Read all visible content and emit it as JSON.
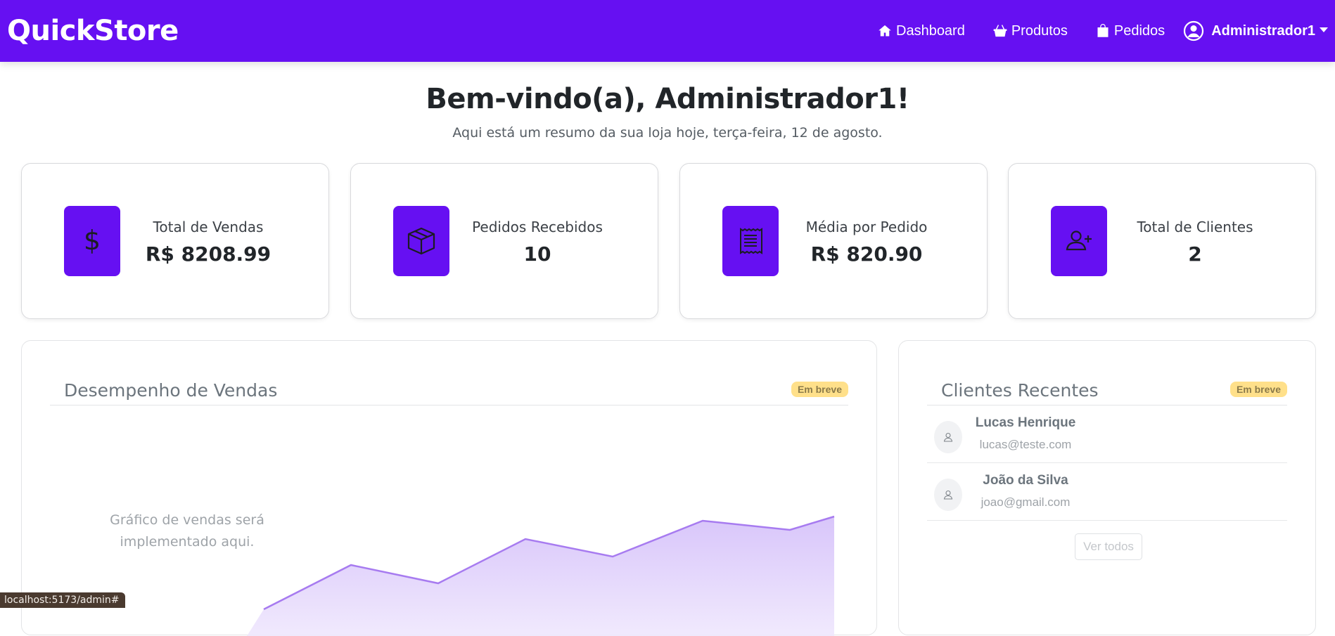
{
  "brand": "QuickStore",
  "nav": {
    "dashboard": "Dashboard",
    "produtos": "Produtos",
    "pedidos": "Pedidos",
    "user": "Administrador1"
  },
  "welcome": {
    "title": "Bem-vindo(a), Administrador1!",
    "subtitle": "Aqui está um resumo da sua loja hoje, terça-feira, 12 de agosto."
  },
  "stats": [
    {
      "label": "Total de Vendas",
      "value": "R$ 8208.99",
      "icon": "dollar-icon"
    },
    {
      "label": "Pedidos Recebidos",
      "value": "10",
      "icon": "box-icon"
    },
    {
      "label": "Média por Pedido",
      "value": "R$ 820.90",
      "icon": "receipt-icon"
    },
    {
      "label": "Total de Clientes",
      "value": "2",
      "icon": "person-plus-icon"
    }
  ],
  "sales_panel": {
    "title": "Desempenho de Vendas",
    "badge": "Em breve",
    "placeholder_line1": "Gráfico de vendas será",
    "placeholder_line2": "implementado aqui."
  },
  "clients_panel": {
    "title": "Clientes Recentes",
    "badge": "Em breve",
    "clients": [
      {
        "name": "Lucas Henrique",
        "email": "lucas@teste.com"
      },
      {
        "name": "João da Silva",
        "email": "joao@gmail.com"
      }
    ],
    "view_all": "Ver todos"
  },
  "status_url": "localhost:5173/admin#",
  "colors": {
    "primary": "#6610f2",
    "badge": "#ffe08a",
    "chart_line": "#a77bf0",
    "chart_fill": "#e4d6fb"
  }
}
